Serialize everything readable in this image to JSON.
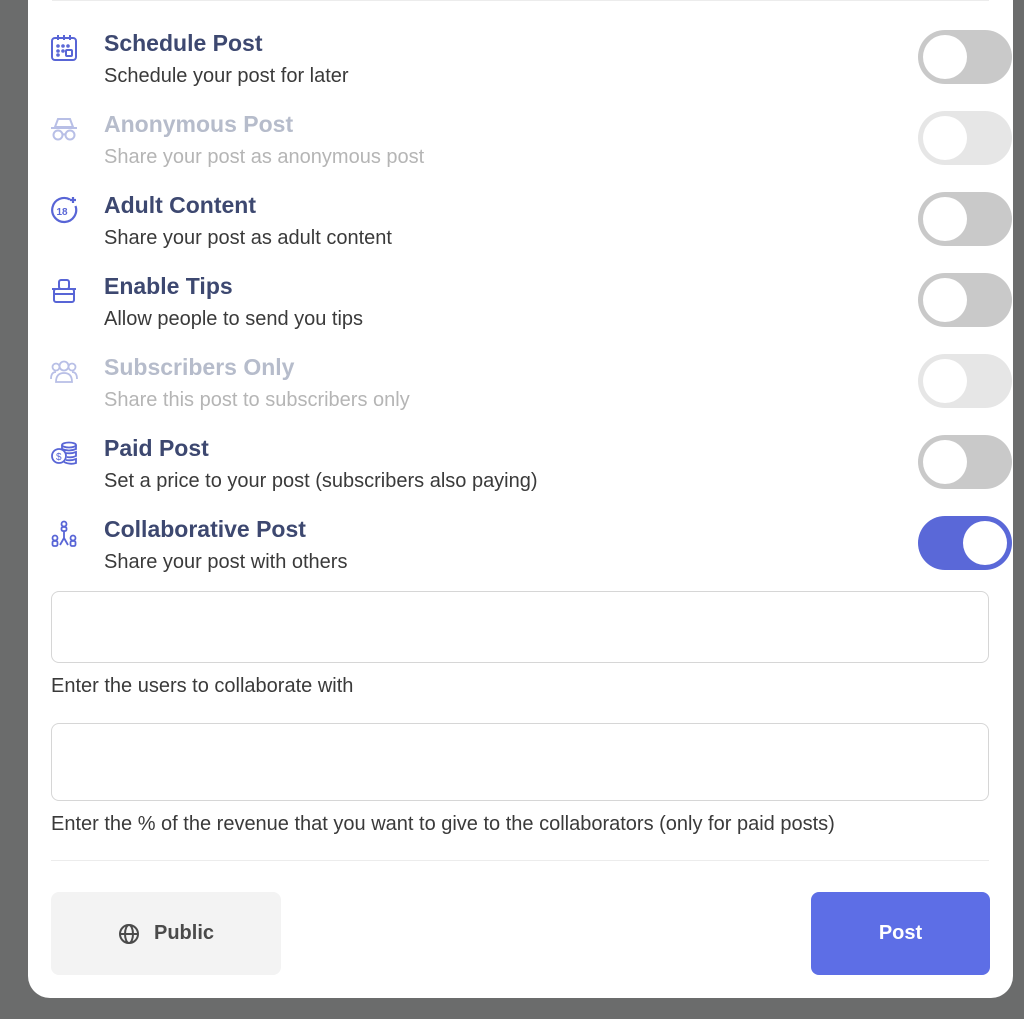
{
  "options": [
    {
      "title": "Schedule Post",
      "desc": "Schedule your post for later",
      "icon": "calendar-icon",
      "enabled": true,
      "on": false
    },
    {
      "title": "Anonymous Post",
      "desc": "Share your post as anonymous post",
      "icon": "incognito-icon",
      "enabled": false,
      "on": false
    },
    {
      "title": "Adult Content",
      "desc": "Share your post as adult content",
      "icon": "adult-18-plus-icon",
      "enabled": true,
      "on": false
    },
    {
      "title": "Enable Tips",
      "desc": "Allow people to send you tips",
      "icon": "tip-jar-icon",
      "enabled": true,
      "on": false
    },
    {
      "title": "Subscribers Only",
      "desc": "Share this post to subscribers only",
      "icon": "users-icon",
      "enabled": false,
      "on": false
    },
    {
      "title": "Paid Post",
      "desc": "Set a price to your post (subscribers also paying)",
      "icon": "coins-icon",
      "enabled": true,
      "on": false
    },
    {
      "title": "Collaborative Post",
      "desc": "Share your post with others",
      "icon": "collaboration-icon",
      "enabled": true,
      "on": true
    }
  ],
  "collaborators": {
    "value": "",
    "hint": "Enter the users to collaborate with"
  },
  "revenue_share": {
    "value": "",
    "hint": "Enter the % of the revenue that you want to give to the collaborators (only for paid posts)"
  },
  "footer": {
    "visibility_label": "Public",
    "visibility_icon": "globe-icon",
    "post_label": "Post"
  },
  "colors": {
    "accent": "#5d6ee6",
    "title": "#3d4870",
    "toggle_off": "#c9c9c9",
    "backdrop": "#6b6c6c"
  }
}
